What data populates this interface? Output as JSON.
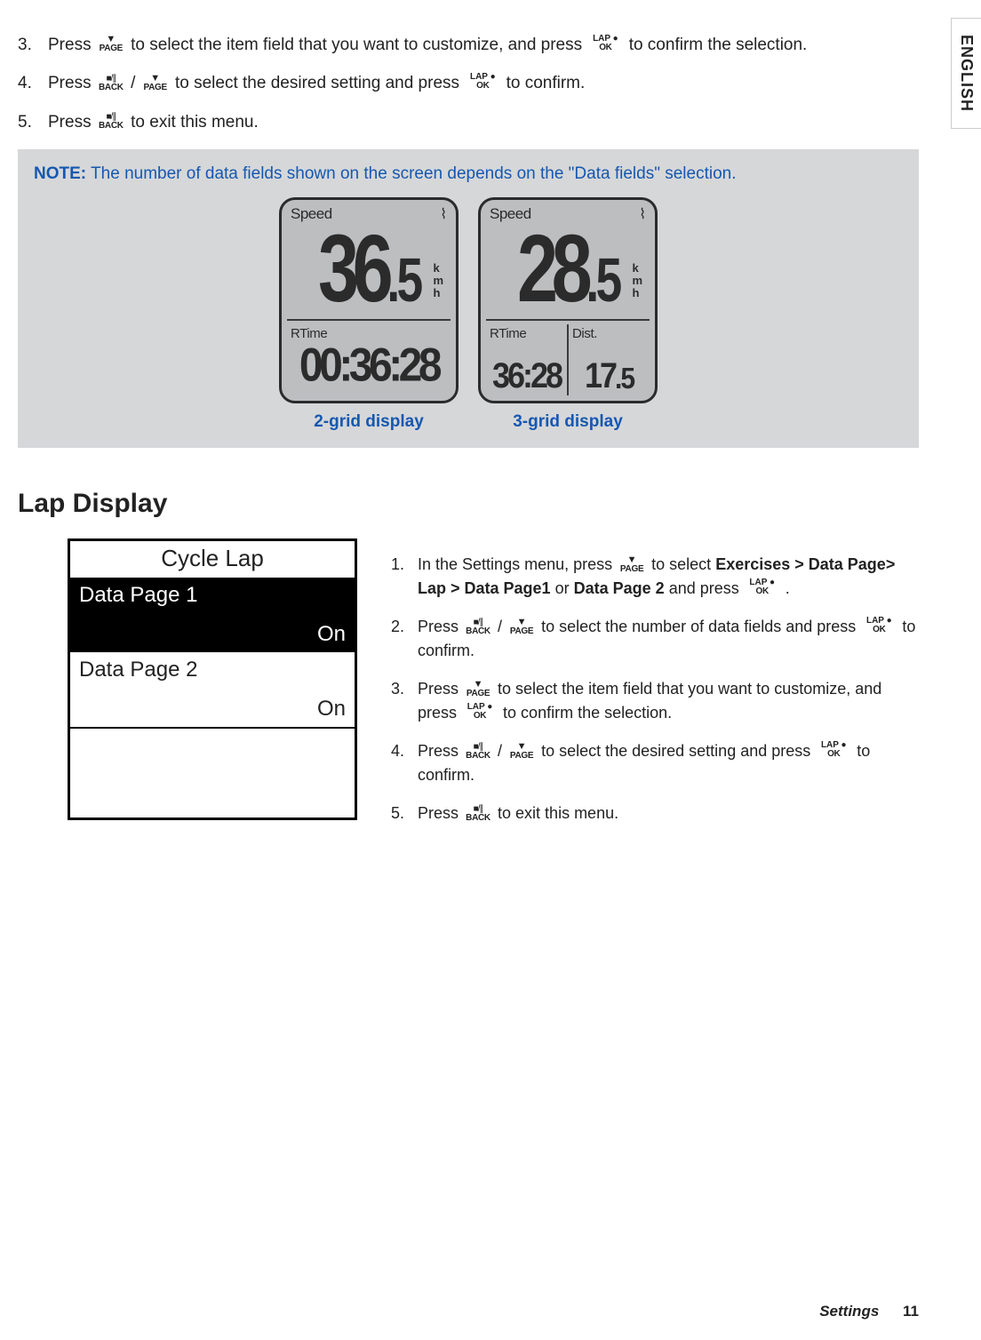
{
  "language_tab": "ENGLISH",
  "top_steps": [
    {
      "num": "3.",
      "pre": "Press ",
      "mid": " to select the item field that you want to customize, and press ",
      "post": " to confirm the selection."
    },
    {
      "num": "4.",
      "pre": "Press ",
      "slash": "/",
      "mid": " to select the desired setting and press ",
      "post": " to confirm."
    },
    {
      "num": "5.",
      "pre": "Press ",
      "post": " to exit this menu."
    }
  ],
  "note": {
    "label": "NOTE:",
    "text": " The number of data fields shown on the screen depends on the \"Data fields\" selection."
  },
  "screens": {
    "two_grid": {
      "top_label": "Speed",
      "big": "36",
      "dec": ".5",
      "unit": "k\nm\nh",
      "bot_label": "RTime",
      "bot_value": "00:36:28",
      "caption": "2-grid display"
    },
    "three_grid": {
      "top_label": "Speed",
      "big": "28",
      "dec": ".5",
      "unit": "k\nm\nh",
      "bot1_label": "RTime",
      "bot1_value": "36:28",
      "bot2_label": "Dist.",
      "bot2_value": "17",
      "bot2_dec": ".5",
      "caption": "3-grid display"
    }
  },
  "lap_heading": "Lap Display",
  "cycle_lap_panel": {
    "title": "Cycle Lap",
    "row1_label": "Data Page 1",
    "row1_status": "On",
    "row2_label": "Data Page 2",
    "row2_status": "On"
  },
  "lap_steps": [
    {
      "num": "1.",
      "s1": "In the Settings menu, press ",
      "s2": " to select ",
      "path": "Exercises > Data Page> Lap > Data Page1",
      "or": " or ",
      "path2": "Data Page 2",
      "s3": " and press ",
      "s4": "."
    },
    {
      "num": "2.",
      "s1": "Press ",
      "slash": "/",
      "s2": " to select the number of data fields and press ",
      "s3": " to confirm."
    },
    {
      "num": "3.",
      "s1": "Press ",
      "s2": " to select the item field that you want to customize, and press ",
      "s3": " to confirm the selection."
    },
    {
      "num": "4.",
      "s1": "Press ",
      "slash": "/",
      "s2": " to select the desired setting and press ",
      "s3": " to confirm."
    },
    {
      "num": "5.",
      "s1": "Press ",
      "s2": " to exit this menu."
    }
  ],
  "footer": {
    "section": "Settings",
    "page": "11"
  }
}
